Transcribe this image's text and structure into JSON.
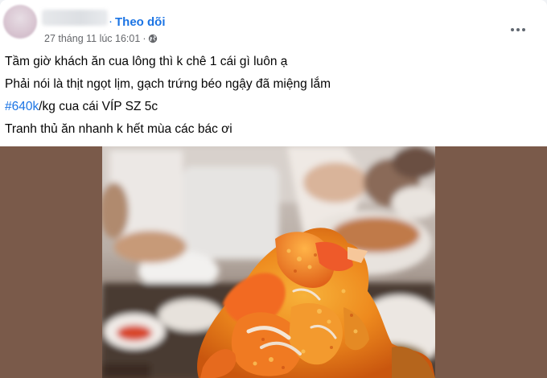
{
  "post": {
    "header": {
      "follow_label": "Theo dõi",
      "dot": "·",
      "timestamp": "27 tháng 11 lúc 16:01",
      "meta_sep": "·",
      "privacy_icon": "globe-icon",
      "more_icon": "more-options-icon"
    },
    "text": {
      "line1": "Tầm giờ khách ăn cua lông thì k chê 1 cái gì luôn ạ",
      "line2": "Phải nói là thịt ngọt lịm, gạch trứng béo ngậy đã miệng lắm",
      "line3_hashtag": "#640k",
      "line3_rest": "/kg cua cái VÍP SZ 5c",
      "line4": "Tranh thủ ăn nhanh k hết mùa các bác ơi"
    },
    "colors": {
      "link": "#1b74e4",
      "text": "#050505",
      "secondary": "#65676b",
      "media_background": "#7a5a4a"
    }
  }
}
